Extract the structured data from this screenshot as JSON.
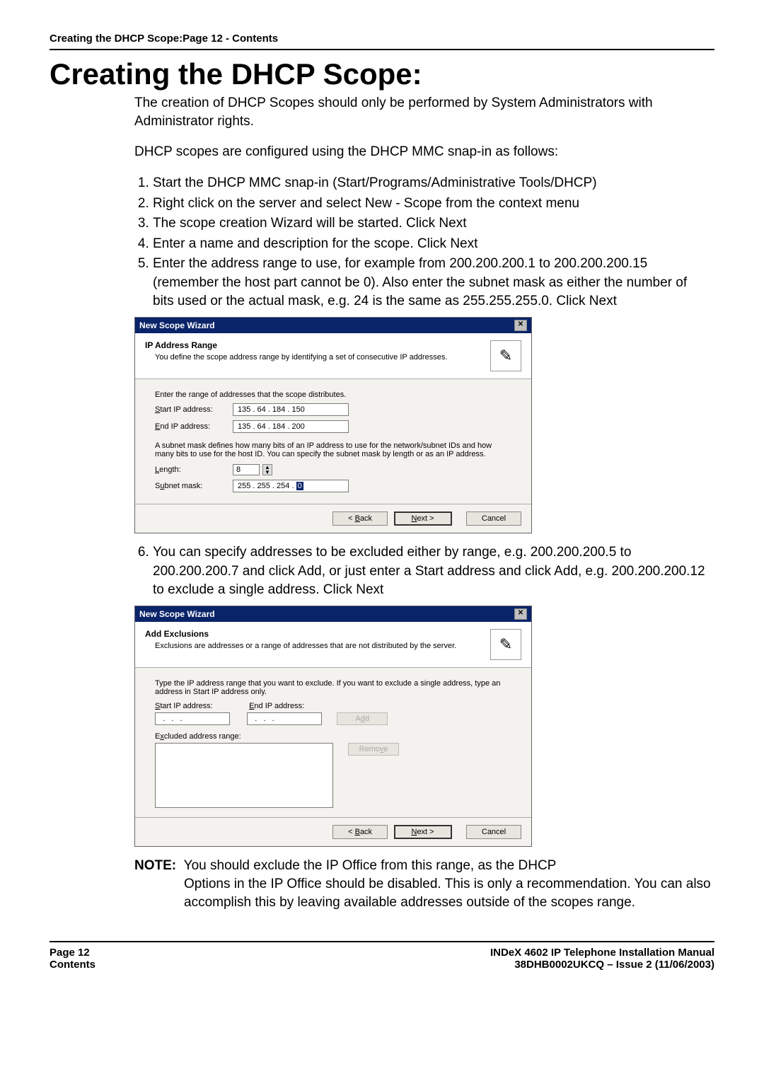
{
  "header_line": "Creating the DHCP Scope:Page 12 - Contents",
  "title": "Creating the DHCP Scope:",
  "intro1": "The creation of DHCP Scopes should only be performed by System Administrators with Administrator rights.",
  "intro2": "DHCP scopes are configured using the DHCP MMC snap-in as follows:",
  "steps_a": [
    "Start the DHCP MMC snap-in (Start/Programs/Administrative Tools/DHCP)",
    "Right click on the server and select New - Scope from the context menu",
    "The scope creation Wizard will be started. Click Next",
    "Enter a name and description for the scope. Click Next",
    "Enter the address range to use, for example from 200.200.200.1 to 200.200.200.15 (remember the host part cannot be 0). Also enter the subnet mask as either the number of bits used or the actual mask, e.g. 24 is the same as 255.255.255.0. Click Next"
  ],
  "step6": "You can specify addresses to be excluded either by range, e.g. 200.200.200.5 to 200.200.200.7 and click Add, or just enter a Start address and click Add, e.g. 200.200.200.12 to exclude a single address. Click Next",
  "wizard1": {
    "window_title": "New Scope Wizard",
    "head_title": "IP Address Range",
    "head_sub": "You define the scope address range by identifying a set of consecutive IP addresses.",
    "line1": "Enter the range of addresses that the scope distributes.",
    "start_label": "Start IP address:",
    "start_value": "135 .  64 . 184 . 150",
    "end_label": "End IP address:",
    "end_value": "135 .  64 . 184 . 200",
    "mask_text": "A subnet mask defines how many bits of an IP address to use for the network/subnet IDs and how many bits to use for the host ID. You can specify the subnet mask by length or as an IP address.",
    "length_label": "Length:",
    "length_value": "8",
    "subnet_label": "Subnet mask:",
    "subnet_value_prefix": "255 . 255 . 254 .  ",
    "subnet_value_sel": "0",
    "btn_back": "< Back",
    "btn_next": "Next >",
    "btn_cancel": "Cancel"
  },
  "wizard2": {
    "window_title": "New Scope Wizard",
    "head_title": "Add Exclusions",
    "head_sub": "Exclusions are addresses or a range of addresses that are not distributed by the server.",
    "instr": "Type the IP address range that you want to exclude. If you want to exclude a single address, type an address in Start IP address only.",
    "start_label": "Start IP address:",
    "end_label": "End IP address:",
    "add_btn": "Add",
    "excl_label": "Excluded address range:",
    "remove_btn": "Remove",
    "btn_back": "< Back",
    "btn_next": "Next >",
    "btn_cancel": "Cancel"
  },
  "note_label": "NOTE",
  "note_text": "You should exclude the IP Office from this range, as the DHCP Options in the IP Office should be disabled. This is only a recommendation. You can also accomplish this by leaving available addresses outside of the scopes range.",
  "footer": {
    "page": "Page 12",
    "contents": "Contents",
    "manual": "INDeX 4602 IP Telephone Installation Manual",
    "issue": "38DHB0002UKCQ – Issue 2 (11/06/2003)"
  }
}
